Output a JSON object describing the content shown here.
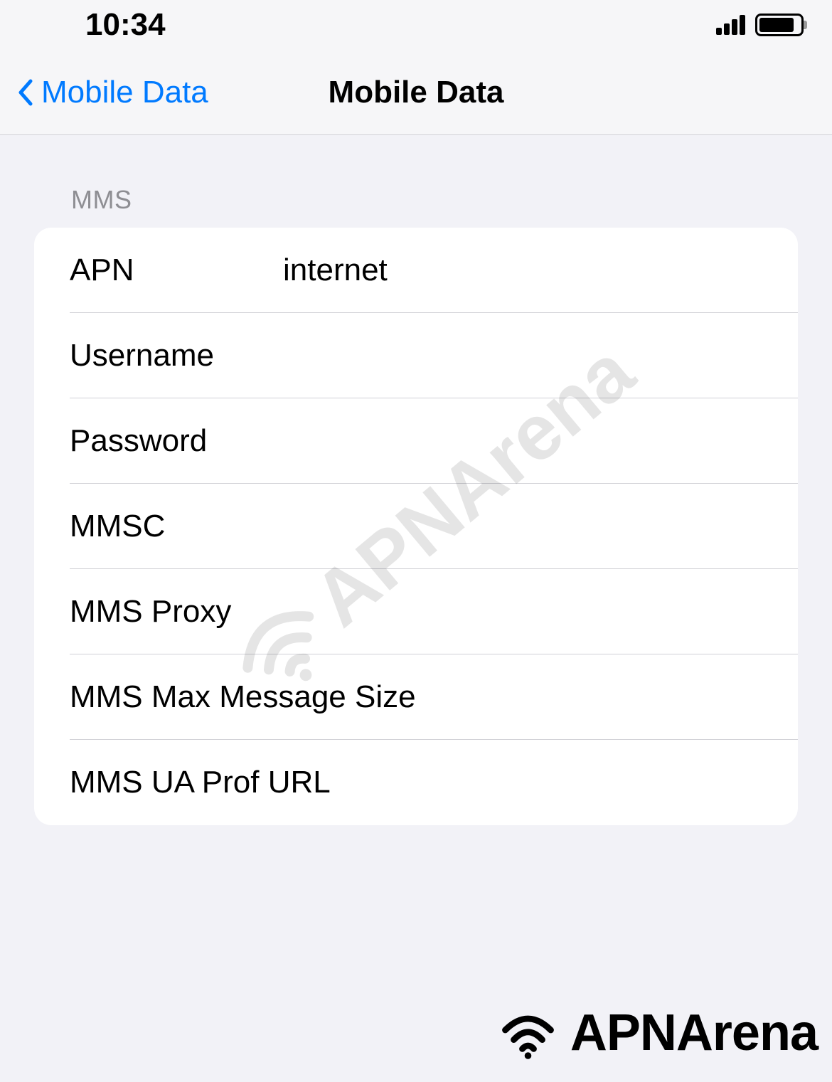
{
  "status_bar": {
    "time": "10:34"
  },
  "nav": {
    "back_label": "Mobile Data",
    "title": "Mobile Data"
  },
  "section": {
    "header": "MMS",
    "rows": [
      {
        "label": "APN",
        "value": "internet"
      },
      {
        "label": "Username",
        "value": ""
      },
      {
        "label": "Password",
        "value": ""
      },
      {
        "label": "MMSC",
        "value": ""
      },
      {
        "label": "MMS Proxy",
        "value": ""
      },
      {
        "label": "MMS Max Message Size",
        "value": ""
      },
      {
        "label": "MMS UA Prof URL",
        "value": ""
      }
    ]
  },
  "watermark": "APNArena",
  "brand": "APNArena"
}
